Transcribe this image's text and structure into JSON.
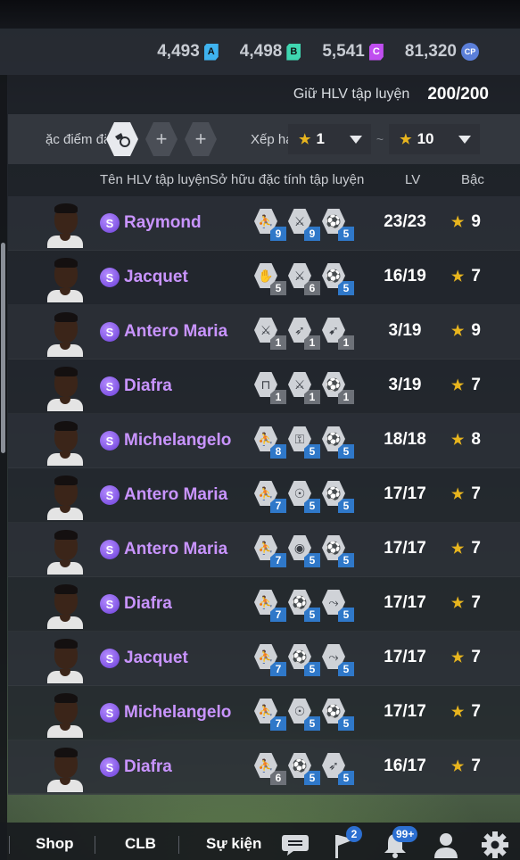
{
  "currencies": [
    {
      "value": "4,493",
      "badge": "A",
      "icon": "a-token-icon"
    },
    {
      "value": "4,498",
      "badge": "B",
      "icon": "b-token-icon"
    },
    {
      "value": "5,541",
      "badge": "C",
      "icon": "c-token-icon"
    },
    {
      "value": "81,320",
      "badge": "CP",
      "icon": "cp-coin-icon"
    }
  ],
  "limit": {
    "label": "Giữ HLV tập luyện",
    "value": "200/200"
  },
  "filter": {
    "trait_label": "ặc điểm đặc",
    "rank_label": "Xếp hạ",
    "min_rank": "1",
    "max_rank": "10",
    "separator": "~",
    "colors": {
      "star": "#e8b51e"
    }
  },
  "columns": {
    "name": "Tên HLV tập luyện",
    "traits": "Sở hữu đặc tính tập luyện",
    "lv": "LV",
    "rank": "Bậc"
  },
  "rows": [
    {
      "name": "Raymond",
      "season": "S",
      "lv": "23/23",
      "rank": "9",
      "traits": [
        {
          "icon": "dribble-trait-icon",
          "level": "9",
          "color": "blue"
        },
        {
          "icon": "tackle-trait-icon",
          "level": "9",
          "color": "blue"
        },
        {
          "icon": "shoot-trait-icon",
          "level": "5",
          "color": "blue"
        }
      ]
    },
    {
      "name": "Jacquet",
      "season": "S",
      "lv": "16/19",
      "rank": "7",
      "traits": [
        {
          "icon": "goalkeeper-trait-icon",
          "level": "5",
          "color": "gray"
        },
        {
          "icon": "tackle-trait-icon",
          "level": "6",
          "color": "gray"
        },
        {
          "icon": "shoot-trait-icon",
          "level": "5",
          "color": "blue"
        }
      ]
    },
    {
      "name": "Antero Maria",
      "season": "S",
      "lv": "3/19",
      "rank": "9",
      "traits": [
        {
          "icon": "tackle-trait-icon",
          "level": "1",
          "color": "gray"
        },
        {
          "icon": "kick-trait-icon",
          "level": "1",
          "color": "gray"
        },
        {
          "icon": "pass-trait-icon",
          "level": "1",
          "color": "gray"
        }
      ]
    },
    {
      "name": "Diafra",
      "season": "S",
      "lv": "3/19",
      "rank": "7",
      "traits": [
        {
          "icon": "goal-trait-icon",
          "level": "1",
          "color": "gray"
        },
        {
          "icon": "tackle-trait-icon",
          "level": "1",
          "color": "gray"
        },
        {
          "icon": "shoot-trait-icon",
          "level": "1",
          "color": "gray"
        }
      ]
    },
    {
      "name": "Michelangelo",
      "season": "S",
      "lv": "18/18",
      "rank": "8",
      "traits": [
        {
          "icon": "dribble-trait-icon",
          "level": "8",
          "color": "blue"
        },
        {
          "icon": "lock-trait-icon",
          "level": "5",
          "color": "blue"
        },
        {
          "icon": "shoot-trait-icon",
          "level": "5",
          "color": "blue"
        }
      ]
    },
    {
      "name": "Antero Maria",
      "season": "S",
      "lv": "17/17",
      "rank": "7",
      "traits": [
        {
          "icon": "dribble-trait-icon",
          "level": "7",
          "color": "blue"
        },
        {
          "icon": "header-trait-icon",
          "level": "5",
          "color": "blue"
        },
        {
          "icon": "shoot-trait-icon",
          "level": "5",
          "color": "blue"
        }
      ]
    },
    {
      "name": "Antero Maria",
      "season": "S",
      "lv": "17/17",
      "rank": "7",
      "traits": [
        {
          "icon": "dribble-trait-icon",
          "level": "7",
          "color": "blue"
        },
        {
          "icon": "ball-trait-icon",
          "level": "5",
          "color": "blue"
        },
        {
          "icon": "shoot-trait-icon",
          "level": "5",
          "color": "blue"
        }
      ]
    },
    {
      "name": "Diafra",
      "season": "S",
      "lv": "17/17",
      "rank": "7",
      "traits": [
        {
          "icon": "dribble-trait-icon",
          "level": "7",
          "color": "blue"
        },
        {
          "icon": "shoot-trait-icon",
          "level": "5",
          "color": "blue"
        },
        {
          "icon": "cross-trait-icon",
          "level": "5",
          "color": "blue"
        }
      ]
    },
    {
      "name": "Jacquet",
      "season": "S",
      "lv": "17/17",
      "rank": "7",
      "traits": [
        {
          "icon": "dribble-trait-icon",
          "level": "7",
          "color": "blue"
        },
        {
          "icon": "shoot-trait-icon",
          "level": "5",
          "color": "blue"
        },
        {
          "icon": "cross-trait-icon",
          "level": "5",
          "color": "blue"
        }
      ]
    },
    {
      "name": "Michelangelo",
      "season": "S",
      "lv": "17/17",
      "rank": "7",
      "traits": [
        {
          "icon": "dribble-trait-icon",
          "level": "7",
          "color": "blue"
        },
        {
          "icon": "header-trait-icon",
          "level": "5",
          "color": "blue"
        },
        {
          "icon": "shoot-trait-icon",
          "level": "5",
          "color": "blue"
        }
      ]
    },
    {
      "name": "Diafra",
      "season": "S",
      "lv": "16/17",
      "rank": "7",
      "traits": [
        {
          "icon": "dribble-trait-icon",
          "level": "6",
          "color": "gray"
        },
        {
          "icon": "shoot-trait-icon",
          "level": "5",
          "color": "blue"
        },
        {
          "icon": "kick-trait-icon",
          "level": "5",
          "color": "blue"
        }
      ]
    }
  ],
  "bottom_nav": {
    "shop": "Shop",
    "clb": "CLB",
    "events": "Sự kiện",
    "flag_badge": "2",
    "bell_badge": "99+"
  }
}
